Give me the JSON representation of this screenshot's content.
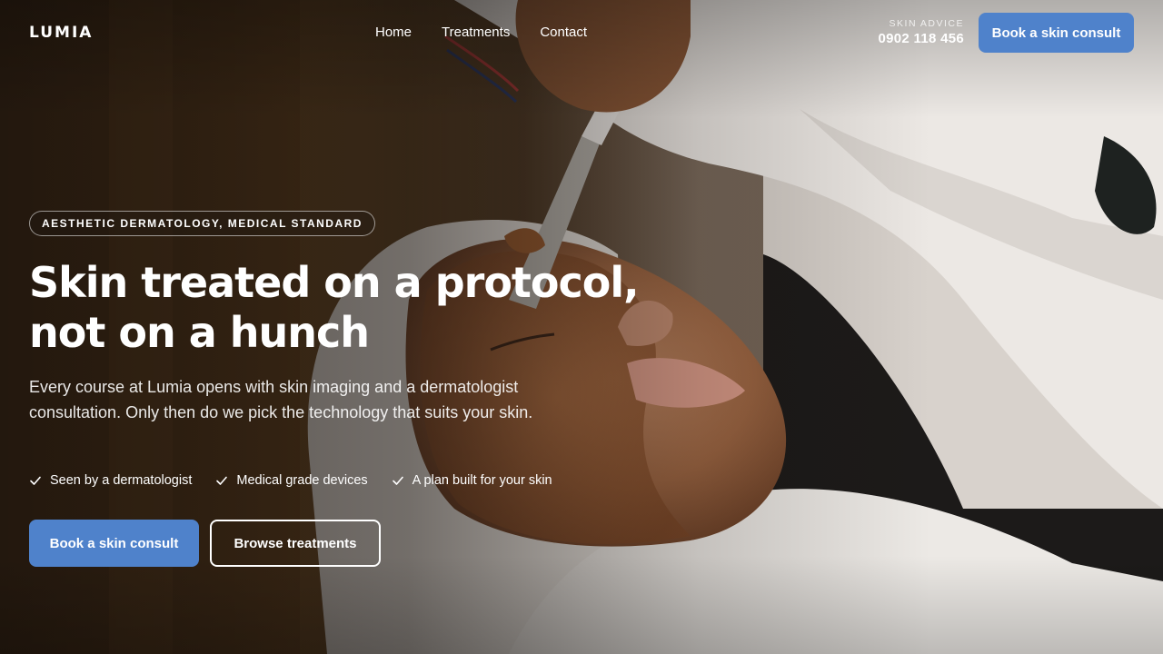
{
  "brand": {
    "name": "LUMIA"
  },
  "nav": {
    "items": [
      "Home",
      "Treatments",
      "Contact"
    ]
  },
  "contact": {
    "label": "SKIN ADVICE",
    "phone": "0902 118 456"
  },
  "header_cta": {
    "label": "Book a skin consult"
  },
  "hero": {
    "badge": "AESTHETIC DERMATOLOGY, MEDICAL STANDARD",
    "headline_line1": "Skin treated on a protocol,",
    "headline_line2": "not on a hunch",
    "lede": "Every course at Lumia opens with skin imaging and a dermatologist consultation. Only then do we pick the technology that suits your skin.",
    "checks": [
      "Seen by a dermatologist",
      "Medical grade devices",
      "A plan built for your skin"
    ],
    "primary_cta": "Book a skin consult",
    "secondary_cta": "Browse treatments"
  },
  "colors": {
    "accent": "#4f82cb",
    "text": "#ffffff"
  },
  "icons": {
    "check": "check-icon"
  }
}
